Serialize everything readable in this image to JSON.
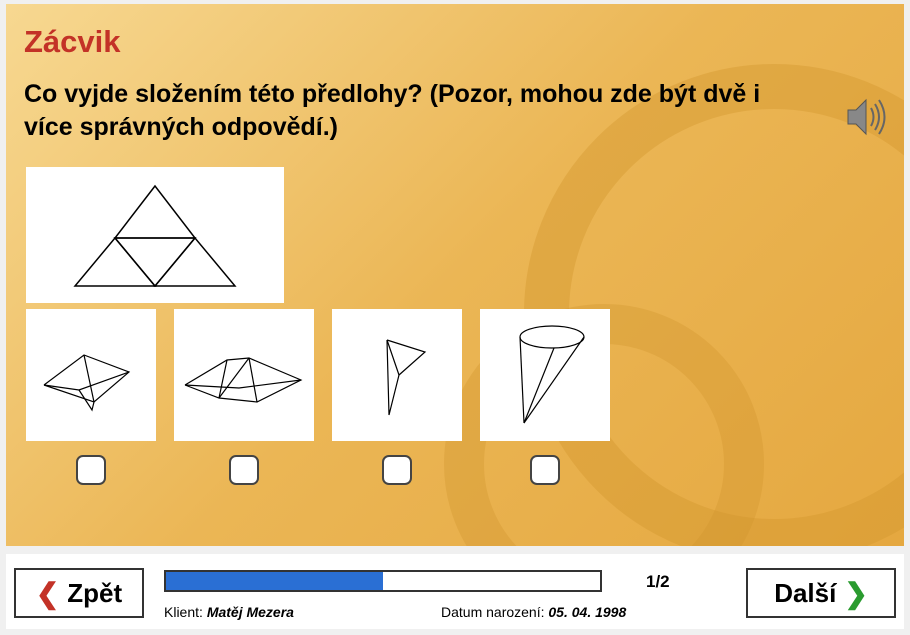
{
  "title": "Zácvik",
  "question": "Co vyjde složením této předlohy? (Pozor, mohou zde být dvě i více správných odpovědí.)",
  "options_count": 4,
  "footer": {
    "back_label": "Zpět",
    "next_label": "Další",
    "page_indicator": "1/2",
    "progress_percent": 50,
    "client_label": "Klient: ",
    "client_name": "Matěj Mezera",
    "dob_label": "Datum narození: ",
    "dob_value": "05. 04. 1998"
  }
}
